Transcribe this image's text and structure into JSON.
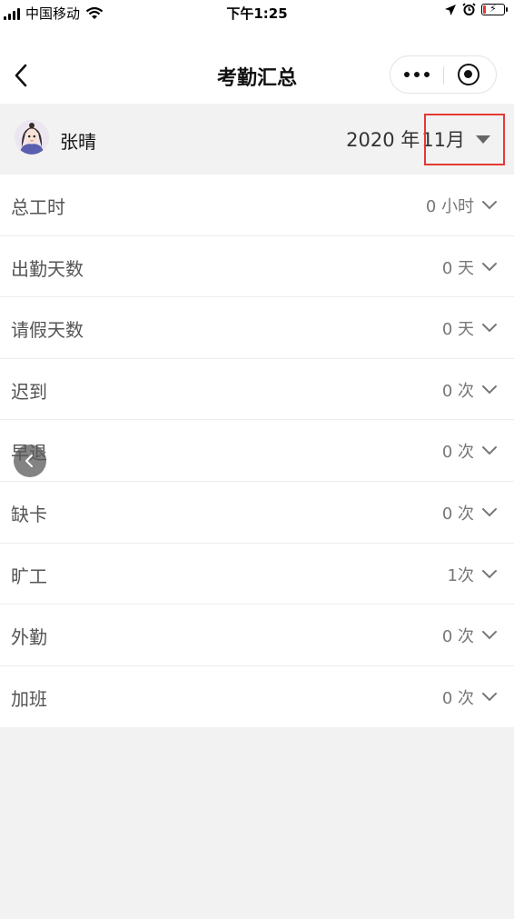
{
  "status_bar": {
    "carrier": "中国移动",
    "time": "下午1:25"
  },
  "nav": {
    "title": "考勤汇总"
  },
  "user": {
    "name": "张晴"
  },
  "period": {
    "year": "2020 年",
    "month": "11月"
  },
  "summary_items": [
    {
      "label": "总工时",
      "value": "0 小时"
    },
    {
      "label": "出勤天数",
      "value": "0 天"
    },
    {
      "label": "请假天数",
      "value": "0 天"
    },
    {
      "label": "迟到",
      "value": "0 次"
    },
    {
      "label": "早退",
      "value": "0 次"
    },
    {
      "label": "缺卡",
      "value": "0 次"
    },
    {
      "label": "旷工",
      "value": "1次"
    },
    {
      "label": "外勤",
      "value": "0 次"
    },
    {
      "label": "加班",
      "value": "0 次"
    }
  ],
  "colors": {
    "highlight": "#e53935",
    "background": "#f2f2f2"
  }
}
